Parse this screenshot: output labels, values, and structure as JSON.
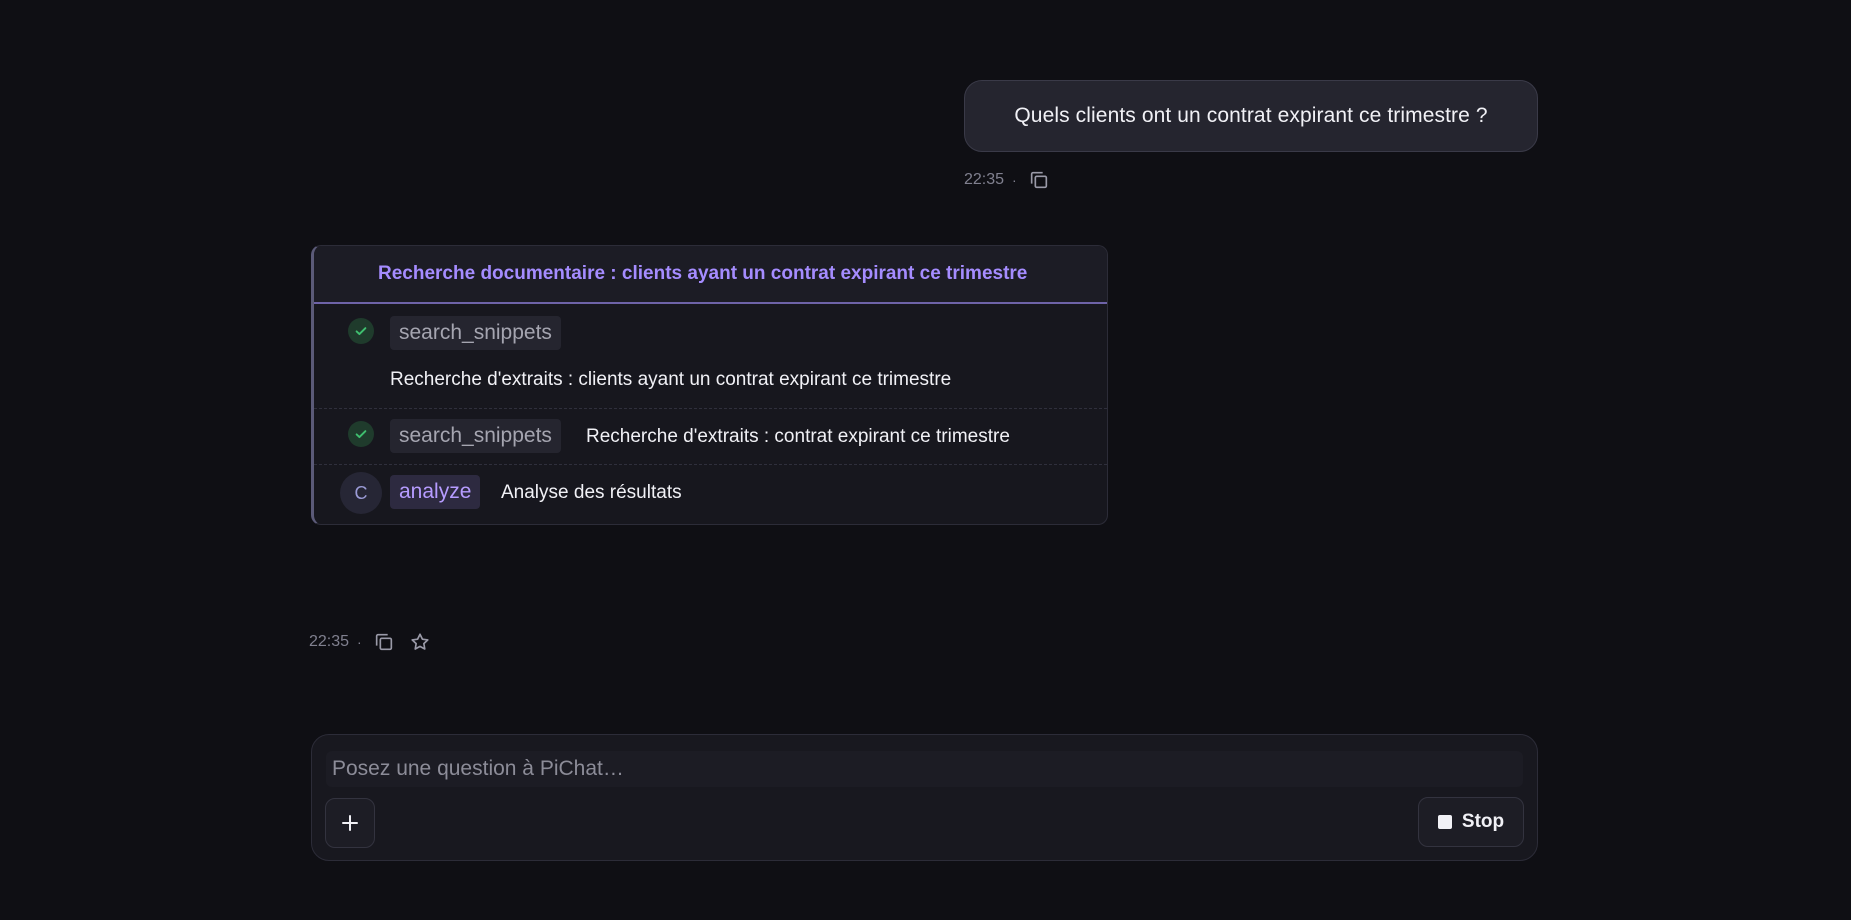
{
  "theme": {
    "background": "#0f0f14",
    "accent": "#a58cff",
    "success": "#3fbf6f"
  },
  "conversation": {
    "user_message": {
      "text": "Quels clients ont un contrat expirant ce trimestre ?",
      "time": "22:35",
      "separator": "·",
      "icons": [
        "copy-icon"
      ]
    },
    "tool_panel": {
      "title": "Recherche documentaire : clients ayant un contrat expirant ce trimestre",
      "steps": [
        {
          "tool": "search_snippets",
          "status": "done",
          "status_icon": "check-circle-icon",
          "description": "Recherche d'extraits : clients ayant un contrat expirant ce trimestre"
        },
        {
          "tool": "search_snippets",
          "status": "done",
          "status_icon": "check-circle-icon",
          "description": "Recherche d'extraits : contrat expirant ce trimestre"
        },
        {
          "tool": "analyze",
          "status": "running",
          "status_glyph": "C",
          "description": "Analyse des résultats"
        }
      ]
    },
    "assistant_meta": {
      "time": "22:35",
      "separator": "·",
      "icons": [
        "copy-icon",
        "star-icon"
      ]
    }
  },
  "composer": {
    "placeholder": "Posez une question à PiChat…",
    "value": "",
    "attach_icon": "plus-icon",
    "stop_label": "Stop",
    "stop_icon": "stop-square-icon"
  }
}
